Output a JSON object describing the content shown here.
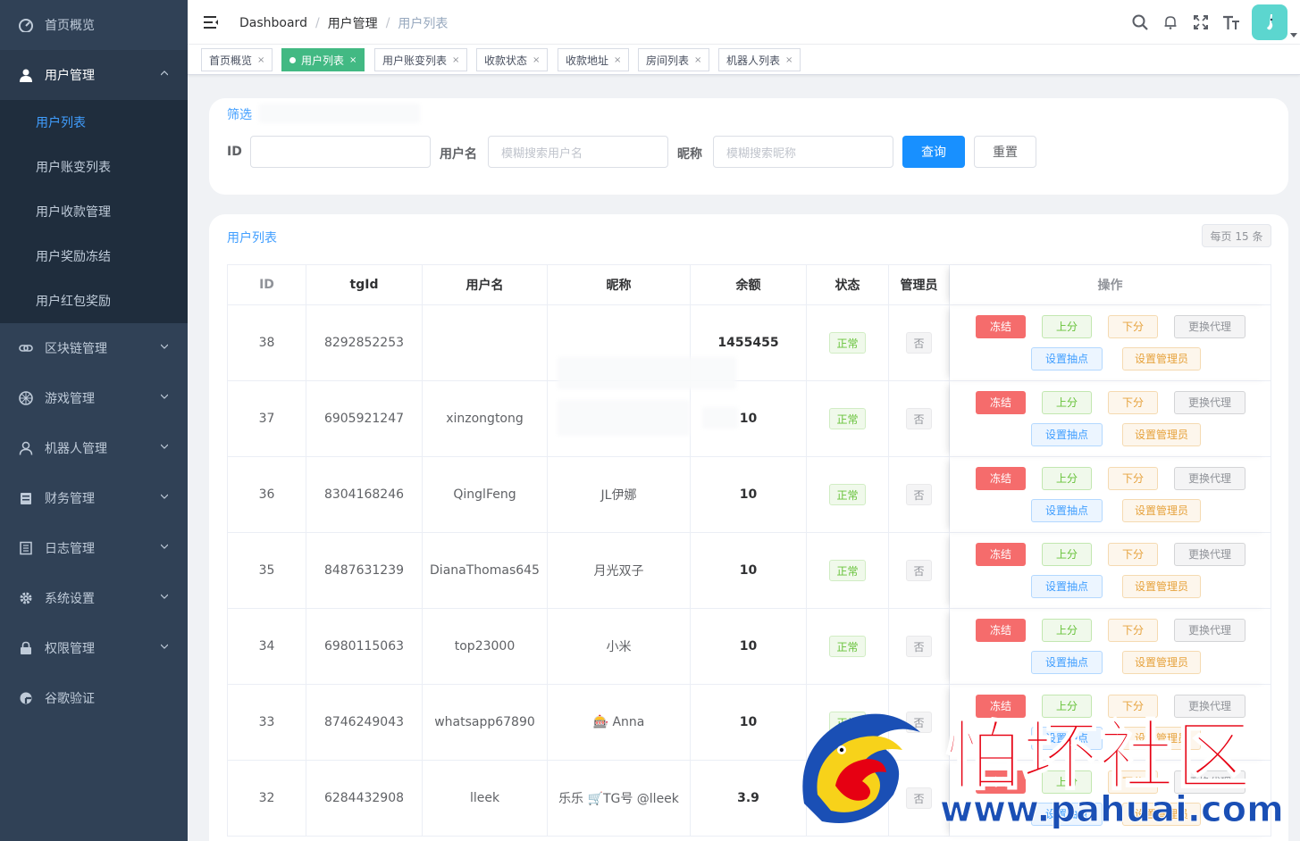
{
  "sidebar": {
    "items": [
      {
        "label": "首页概览",
        "icon": "dashboard-icon"
      },
      {
        "label": "用户管理",
        "icon": "user-icon",
        "expanded": true
      },
      {
        "label": "区块链管理",
        "icon": "chain-icon"
      },
      {
        "label": "游戏管理",
        "icon": "game-icon"
      },
      {
        "label": "机器人管理",
        "icon": "robot-icon"
      },
      {
        "label": "财务管理",
        "icon": "finance-icon"
      },
      {
        "label": "日志管理",
        "icon": "log-icon"
      },
      {
        "label": "系统设置",
        "icon": "gear-icon"
      },
      {
        "label": "权限管理",
        "icon": "lock-icon"
      },
      {
        "label": "谷歌验证",
        "icon": "google-icon"
      }
    ],
    "user_submenu": [
      "用户列表",
      "用户账变列表",
      "用户收款管理",
      "用户奖励冻结",
      "用户红包奖励"
    ],
    "colors": {
      "bg": "#304156",
      "active": "#409eff"
    }
  },
  "navbar": {
    "breadcrumb": [
      "Dashboard",
      "用户管理",
      "用户列表"
    ]
  },
  "tags": [
    {
      "label": "首页概览",
      "active": false
    },
    {
      "label": "用户列表",
      "active": true
    },
    {
      "label": "用户账变列表",
      "active": false
    },
    {
      "label": "收款状态",
      "active": false
    },
    {
      "label": "收款地址",
      "active": false
    },
    {
      "label": "房间列表",
      "active": false
    },
    {
      "label": "机器人列表",
      "active": false
    }
  ],
  "filter": {
    "title": "筛选",
    "id_label": "ID",
    "username_label": "用户名",
    "username_placeholder": "模糊搜索用户名",
    "nickname_label": "昵称",
    "nickname_placeholder": "模糊搜索昵称",
    "search_button": "查询",
    "reset_button": "重置"
  },
  "list": {
    "title": "用户列表",
    "per_page": "每页 15 条",
    "columns": [
      "ID",
      "tgId",
      "用户名",
      "昵称",
      "余额",
      "状态",
      "管理员",
      "操作"
    ],
    "actions": {
      "freeze": "冻结",
      "up": "上分",
      "down": "下分",
      "agent": "更换代理",
      "rake": "设置抽点",
      "set_admin": "设置管理员"
    },
    "rows": [
      {
        "id": "38",
        "tgid": "8292852253",
        "username": "",
        "nickname": "",
        "balance": "1455455",
        "status": "正常",
        "admin": "否"
      },
      {
        "id": "37",
        "tgid": "6905921247",
        "username": "xinzongtong",
        "nickname": "",
        "balance": "10",
        "status": "正常",
        "admin": "否"
      },
      {
        "id": "36",
        "tgid": "8304168246",
        "username": "QinglFeng",
        "nickname": "JL伊娜",
        "balance": "10",
        "status": "正常",
        "admin": "否"
      },
      {
        "id": "35",
        "tgid": "8487631239",
        "username": "DianaThomas645",
        "nickname": "月光双子",
        "balance": "10",
        "status": "正常",
        "admin": "否"
      },
      {
        "id": "34",
        "tgid": "6980115063",
        "username": "top23000",
        "nickname": "小米",
        "balance": "10",
        "status": "正常",
        "admin": "否"
      },
      {
        "id": "33",
        "tgid": "8746249043",
        "username": "whatsapp67890",
        "nickname": "🎰 Anna",
        "balance": "10",
        "status": "正常",
        "admin": "否"
      },
      {
        "id": "32",
        "tgid": "6284432908",
        "username": "lleek",
        "nickname": "乐乐 🛒TG号 @lleek",
        "balance": "3.9",
        "status": "正常",
        "admin": "否"
      }
    ]
  },
  "watermark": {
    "line1": "怕坏社区",
    "line2": "www.pahuai.com"
  }
}
